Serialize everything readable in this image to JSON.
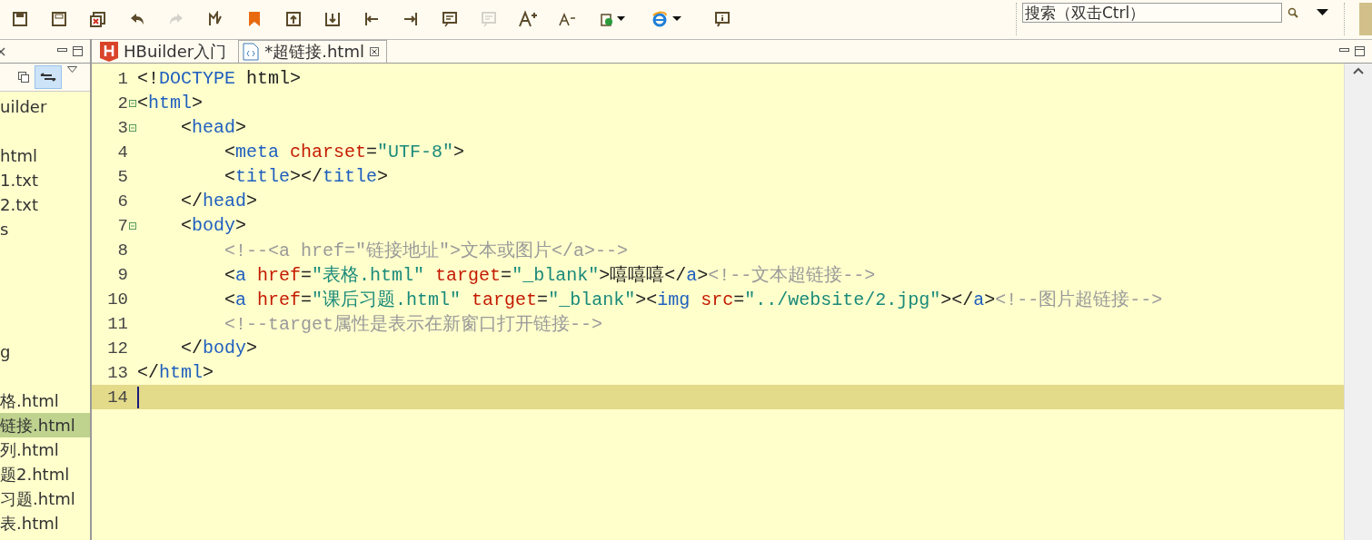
{
  "toolbar": [
    {
      "kind": "saveall",
      "disabled": false
    },
    {
      "kind": "save",
      "disabled": false
    },
    {
      "kind": "close",
      "disabled": false
    },
    {
      "kind": "undo",
      "disabled": false
    },
    {
      "kind": "redo",
      "disabled": true
    },
    {
      "kind": "format",
      "disabled": false
    },
    {
      "kind": "bookmark",
      "disabled": false
    },
    {
      "kind": "up",
      "disabled": false
    },
    {
      "kind": "down",
      "disabled": false
    },
    {
      "kind": "left",
      "disabled": false
    },
    {
      "kind": "right",
      "disabled": false
    },
    {
      "kind": "comment",
      "disabled": false
    },
    {
      "kind": "comment",
      "disabled": true
    },
    {
      "kind": "fontup",
      "disabled": false
    },
    {
      "kind": "fontdown",
      "disabled": false
    },
    {
      "kind": "run",
      "disabled": false
    },
    {
      "kind": "browser",
      "disabled": false
    },
    {
      "kind": "info",
      "disabled": false
    }
  ],
  "search": {
    "placeholder": "搜索（双击Ctrl）"
  },
  "sidebar": {
    "items": [
      {
        "text": "uilder",
        "selected": false
      },
      {
        "selected": false
      },
      {
        "text": "html",
        "selected": false
      },
      {
        "text": "1.txt",
        "selected": false
      },
      {
        "text": "2.txt",
        "selected": false
      },
      {
        "text": "s",
        "selected": false
      },
      {
        "selected": false
      },
      {
        "selected": false
      },
      {
        "selected": false
      },
      {
        "selected": false
      },
      {
        "text": "g",
        "selected": false
      },
      {
        "selected": false
      },
      {
        "text": "格.html",
        "selected": false
      },
      {
        "text": "链接.html",
        "selected": true
      },
      {
        "text": "列.html",
        "selected": false
      },
      {
        "text": "题2.html",
        "selected": false
      },
      {
        "text": "习题.html",
        "selected": false
      },
      {
        "text": "表.html",
        "selected": false
      }
    ]
  },
  "tabs": [
    {
      "label": "HBuilder入门",
      "kind": "hbuilder",
      "selected": false
    },
    {
      "label": "*超链接.html",
      "kind": "html",
      "selected": true
    }
  ],
  "editor": {
    "lines": [
      {
        "number": "1",
        "foldable": false,
        "current": false,
        "tokens": [
          {
            "kind": "punct",
            "t": "<!"
          },
          {
            "kind": "tag",
            "t": "DOCTYPE"
          },
          {
            "kind": "punct",
            "t": " html>"
          }
        ]
      },
      {
        "number": "2",
        "foldable": true,
        "current": false,
        "tokens": [
          {
            "kind": "punct",
            "t": "<"
          },
          {
            "kind": "tag",
            "t": "html"
          },
          {
            "kind": "punct",
            "t": ">"
          }
        ]
      },
      {
        "number": "3",
        "foldable": true,
        "current": false,
        "tokens": [
          {
            "kind": "punct",
            "t": "    <"
          },
          {
            "kind": "tag",
            "t": "head"
          },
          {
            "kind": "punct",
            "t": ">"
          }
        ]
      },
      {
        "number": "4",
        "foldable": false,
        "current": false,
        "tokens": [
          {
            "kind": "punct",
            "t": "        <"
          },
          {
            "kind": "tag",
            "t": "meta"
          },
          {
            "kind": "attr",
            "t": " charset"
          },
          {
            "kind": "punct",
            "t": "="
          },
          {
            "kind": "str",
            "t": "\"UTF-8\""
          },
          {
            "kind": "punct",
            "t": ">"
          }
        ]
      },
      {
        "number": "5",
        "foldable": false,
        "current": false,
        "tokens": [
          {
            "kind": "punct",
            "t": "        <"
          },
          {
            "kind": "tag",
            "t": "title"
          },
          {
            "kind": "punct",
            "t": "></"
          },
          {
            "kind": "tag",
            "t": "title"
          },
          {
            "kind": "punct",
            "t": ">"
          }
        ]
      },
      {
        "number": "6",
        "foldable": false,
        "current": false,
        "tokens": [
          {
            "kind": "punct",
            "t": "    </"
          },
          {
            "kind": "tag",
            "t": "head"
          },
          {
            "kind": "punct",
            "t": ">"
          }
        ]
      },
      {
        "number": "7",
        "foldable": true,
        "current": false,
        "tokens": [
          {
            "kind": "punct",
            "t": "    <"
          },
          {
            "kind": "tag",
            "t": "body"
          },
          {
            "kind": "punct",
            "t": ">"
          }
        ]
      },
      {
        "number": "8",
        "foldable": false,
        "current": false,
        "tokens": [
          {
            "kind": "comment",
            "t": "        <!--<a href=\"链接地址\">文本或图片</a>-->"
          }
        ]
      },
      {
        "number": "9",
        "foldable": false,
        "current": false,
        "tokens": [
          {
            "kind": "punct",
            "t": "        <"
          },
          {
            "kind": "tag",
            "t": "a"
          },
          {
            "kind": "attr",
            "t": " href"
          },
          {
            "kind": "punct",
            "t": "="
          },
          {
            "kind": "str",
            "t": "\"表格.html\""
          },
          {
            "kind": "attr",
            "t": " target"
          },
          {
            "kind": "punct",
            "t": "="
          },
          {
            "kind": "str",
            "t": "\"_blank\""
          },
          {
            "kind": "punct",
            "t": ">嘻嘻嘻</"
          },
          {
            "kind": "tag",
            "t": "a"
          },
          {
            "kind": "punct",
            "t": ">"
          },
          {
            "kind": "comment",
            "t": "<!--文本超链接-->"
          }
        ]
      },
      {
        "number": "10",
        "foldable": false,
        "current": false,
        "tokens": [
          {
            "kind": "punct",
            "t": "        <"
          },
          {
            "kind": "tag",
            "t": "a"
          },
          {
            "kind": "attr",
            "t": " href"
          },
          {
            "kind": "punct",
            "t": "="
          },
          {
            "kind": "str",
            "t": "\"课后习题.html\""
          },
          {
            "kind": "attr",
            "t": " target"
          },
          {
            "kind": "punct",
            "t": "="
          },
          {
            "kind": "str",
            "t": "\"_blank\""
          },
          {
            "kind": "punct",
            "t": "><"
          },
          {
            "kind": "tag",
            "t": "img"
          },
          {
            "kind": "attr",
            "t": " src"
          },
          {
            "kind": "punct",
            "t": "="
          },
          {
            "kind": "str",
            "t": "\"../website/2.jpg\""
          },
          {
            "kind": "punct",
            "t": "></"
          },
          {
            "kind": "tag",
            "t": "a"
          },
          {
            "kind": "punct",
            "t": ">"
          },
          {
            "kind": "comment",
            "t": "<!--图片超链接-->"
          }
        ]
      },
      {
        "number": "11",
        "foldable": false,
        "current": false,
        "tokens": [
          {
            "kind": "comment",
            "t": "        <!--target属性是表示在新窗口打开链接-->"
          }
        ]
      },
      {
        "number": "12",
        "foldable": false,
        "current": false,
        "tokens": [
          {
            "kind": "punct",
            "t": "    </"
          },
          {
            "kind": "tag",
            "t": "body"
          },
          {
            "kind": "punct",
            "t": ">"
          }
        ]
      },
      {
        "number": "13",
        "foldable": false,
        "current": false,
        "tokens": [
          {
            "kind": "punct",
            "t": "</"
          },
          {
            "kind": "tag",
            "t": "html"
          },
          {
            "kind": "punct",
            "t": ">"
          }
        ]
      },
      {
        "number": "14",
        "foldable": false,
        "current": true
      }
    ]
  }
}
